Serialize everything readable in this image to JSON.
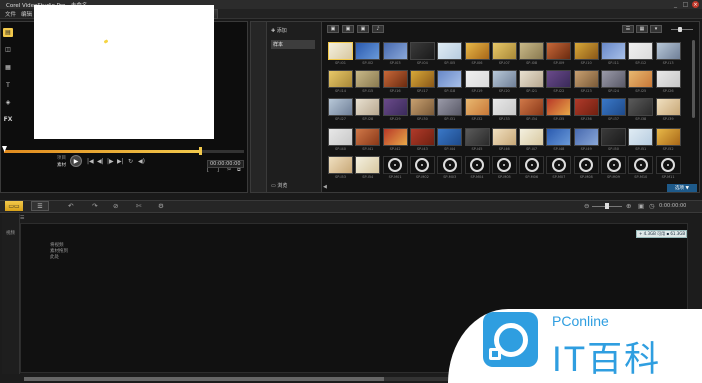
{
  "window": {
    "title": "Corel VideoStudio Pro - 未命名",
    "buttons": [
      "_",
      "□",
      "×"
    ]
  },
  "menu": {
    "items": [
      "文件",
      "编辑",
      "工具",
      "设置"
    ],
    "steps": [
      {
        "num": "1",
        "label": "捕获"
      },
      {
        "num": "2",
        "label": "编辑"
      },
      {
        "num": "3",
        "label": "分享"
      }
    ]
  },
  "preview": {
    "mode_project": "项目",
    "mode_clip": "素材",
    "play_icon": "▶",
    "controls": [
      "|◀",
      "◀|",
      "|▶",
      "▶|",
      "↻",
      "◀)"
    ],
    "edit_icons": [
      "[",
      "]",
      "✂",
      "⧉"
    ],
    "timecode": "00:00:00:00"
  },
  "library": {
    "add_label": "添加",
    "folder_name": "样本",
    "browse_label": "浏览",
    "options_label": "选项 ▼",
    "bottom_arrow": "◀",
    "side_icons": [
      "media-icon",
      "instant-project-icon",
      "transition-icon",
      "title-icon",
      "graphic-icon",
      "filter-icon"
    ],
    "side_glyphs": [
      "▤",
      "◫",
      "▦",
      "T",
      "◈",
      "FX"
    ],
    "toolbar_glyphs": [
      "▣",
      "▣",
      "▣",
      "♪"
    ],
    "view_glyphs": [
      "☰",
      "▦",
      "▾"
    ],
    "thumb_labels": [
      "SP-I01",
      "SP-I02",
      "SP-I03",
      "SP-I04",
      "SP-I05",
      "SP-I06",
      "SP-I07",
      "SP-I08",
      "SP-I09",
      "SP-I10",
      "SP-I11",
      "SP-I12",
      "SP-I13",
      "SP-I14",
      "SP-I15",
      "SP-I16",
      "SP-I17",
      "SP-I18",
      "SP-I19",
      "SP-I20",
      "SP-I21",
      "SP-I22",
      "SP-I23",
      "SP-I24",
      "SP-I25",
      "SP-I26",
      "SP-I27",
      "SP-I28",
      "SP-I29",
      "SP-I30",
      "SP-I31",
      "SP-I32",
      "SP-I33",
      "SP-I34",
      "SP-I35",
      "SP-I36",
      "SP-I37",
      "SP-I38",
      "SP-I39",
      "SP-I40",
      "SP-I41",
      "SP-I42",
      "SP-I43",
      "SP-I44",
      "SP-I45",
      "SP-I46",
      "SP-I47",
      "SP-I48",
      "SP-I49",
      "SP-I50",
      "SP-I51",
      "SP-I52",
      "SP-I53",
      "SP-I54",
      "SP-M01",
      "SP-M02",
      "SP-M03",
      "SP-M04",
      "SP-M05",
      "SP-M06",
      "SP-M07",
      "SP-M08",
      "SP-M09",
      "SP-M10",
      "SP-M11"
    ]
  },
  "timeline": {
    "tool_glyphs": [
      "↶",
      "↷",
      "⊘",
      "✄"
    ],
    "timecode": "0:00:00:00",
    "ruler_icon": "☰",
    "track_label": "视频",
    "drop_hint": "将视频\n素材拖到\n此处",
    "capacity": "+ 4.3GB 可用 ▪ 61.3GB"
  },
  "watermark": {
    "brand": "PConline",
    "title": "IT百科"
  },
  "colors": {
    "accent": "#f2c94c",
    "watermark_blue": "#2f9ee0"
  }
}
